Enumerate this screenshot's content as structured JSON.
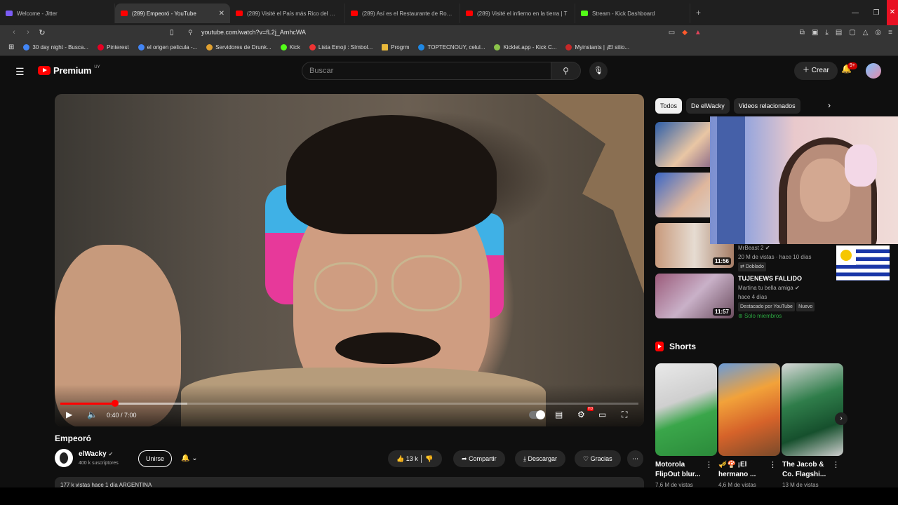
{
  "browser": {
    "tabs": [
      {
        "title": "Welcome - Jitter",
        "color": "#7b5cf5"
      },
      {
        "title": "(289) Empeoró - YouTube",
        "color": "#ff0000"
      },
      {
        "title": "(289) Visité el País más Rico del Mun",
        "color": "#ff0000"
      },
      {
        "title": "(289) Así es el Restaurante de Robot",
        "color": "#ff0000"
      },
      {
        "title": "(289) Visité el infierno en la tierra | T",
        "color": "#ff0000"
      },
      {
        "title": "Stream - Kick Dashboard",
        "color": "#53fc18"
      }
    ],
    "new_tab": "+",
    "url": "youtube.com/watch?v=fL2j_AmhcWA",
    "bookmarks": [
      {
        "label": "30 day night - Busca...",
        "color": "#4285f4"
      },
      {
        "label": "Pinterest",
        "color": "#e60023"
      },
      {
        "label": "el origen pelicula -...",
        "color": "#4285f4"
      },
      {
        "label": "Servidores de Drunk...",
        "color": "#e0a030"
      },
      {
        "label": "Kick",
        "color": "#53fc18"
      },
      {
        "label": "Lista Emoji : Símbol...",
        "color": "#e33"
      },
      {
        "label": "Progrm",
        "color": "#e8b83a"
      },
      {
        "label": "TOPTECNOUY, celul...",
        "color": "#1e88e5"
      },
      {
        "label": "Kicklet.app - Kick C...",
        "color": "#8bc34a"
      },
      {
        "label": "Myinstants | ¡El sitio...",
        "color": "#c62828"
      }
    ]
  },
  "header": {
    "logo_text": "Premium",
    "country": "UY",
    "search_placeholder": "Buscar",
    "create_label": "Crear",
    "notifications": "9+"
  },
  "player": {
    "time": "0:40 / 7:00",
    "progress_fraction": 0.0952,
    "buffered_fraction": 0.22
  },
  "video": {
    "title": "Empeoró",
    "channel": "elWacky",
    "subscribers": "400 k suscriptores",
    "join_label": "Unirse",
    "likes": "13 k",
    "share_label": "Compartir",
    "download_label": "Descargar",
    "thanks_label": "Gracias",
    "description_stats": "177 k vistas  hace 1 día  ARGENTINA"
  },
  "sidebar": {
    "chips": [
      "Todos",
      "De elWacky",
      "Videos relacionados"
    ],
    "recs": [
      {
        "duration": "",
        "channel": "",
        "meta": ""
      },
      {
        "duration": "",
        "channel": "",
        "meta": ""
      },
      {
        "duration": "11:56",
        "channel": "MrBeast 2",
        "meta": "20 M de vistas · hace 10 días",
        "tag": "Doblado"
      },
      {
        "duration": "11:57",
        "title": "TUJENEWS FALLIDO",
        "channel": "Martina tu bella amiga",
        "meta": "hace 4 días",
        "tag": "Destacado por YouTube",
        "tag2": "Nuevo",
        "members": "Solo miembros"
      }
    ],
    "shorts_label": "Shorts",
    "shorts": [
      {
        "title": "Motorola FlipOut blur...",
        "views": "7,6 M de vistas"
      },
      {
        "title": "🎺🍄 ¡El hermano ...",
        "views": "4,6 M de vistas"
      },
      {
        "title": "The Jacob & Co. Flagshi...",
        "views": "13 M de vistas"
      }
    ]
  }
}
